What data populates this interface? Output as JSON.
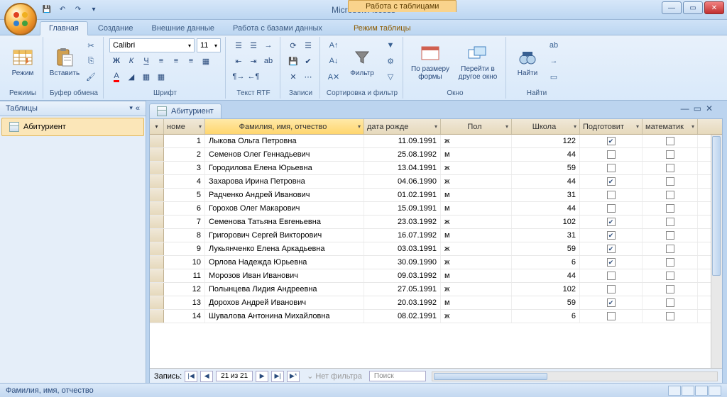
{
  "app": {
    "title": "Microsoft Access",
    "context_title": "Работа с таблицами"
  },
  "window_controls": {
    "min": "—",
    "max": "▭",
    "close": "✕"
  },
  "ribbon_tabs": {
    "items": [
      "Главная",
      "Создание",
      "Внешние данные",
      "Работа с базами данных",
      "Режим таблицы"
    ],
    "active_index": 0
  },
  "ribbon": {
    "views": {
      "label": "Режимы",
      "btn": "Режим"
    },
    "clipboard": {
      "label": "Буфер обмена",
      "paste": "Вставить"
    },
    "font": {
      "label": "Шрифт",
      "family": "Calibri",
      "size": "11"
    },
    "richtext": {
      "label": "Текст RTF"
    },
    "records": {
      "label": "Записи"
    },
    "sort_filter": {
      "label": "Сортировка и фильтр",
      "filter": "Фильтр"
    },
    "window": {
      "label": "Окно",
      "fit": "По размеру формы",
      "switch": "Перейти в другое окно"
    },
    "find": {
      "label": "Найти",
      "btn": "Найти"
    }
  },
  "navpane": {
    "header": "Таблицы",
    "item": "Абитуриент"
  },
  "document": {
    "tab_title": "Абитуриент",
    "columns": [
      "номе",
      "Фамилия, имя, отчество",
      "дата рожде",
      "Пол",
      "Школа",
      "Подготовит",
      "математик"
    ],
    "rows": [
      {
        "id": "1",
        "name": "Лыкова Ольга Петровна",
        "date": "11.09.1991",
        "sex": "ж",
        "school": "122",
        "prep": true
      },
      {
        "id": "2",
        "name": "Семенов Олег Геннадьевич",
        "date": "25.08.1992",
        "sex": "м",
        "school": "44",
        "prep": false
      },
      {
        "id": "3",
        "name": "Городилова Елена Юрьевна",
        "date": "13.04.1991",
        "sex": "ж",
        "school": "59",
        "prep": false
      },
      {
        "id": "4",
        "name": "Захарова Ирина Петровна",
        "date": "04.06.1990",
        "sex": "ж",
        "school": "44",
        "prep": true
      },
      {
        "id": "5",
        "name": "Радченко Андрей Иванович",
        "date": "01.02.1991",
        "sex": "м",
        "school": "31",
        "prep": false
      },
      {
        "id": "6",
        "name": "Горохов Олег Макарович",
        "date": "15.09.1991",
        "sex": "м",
        "school": "44",
        "prep": false
      },
      {
        "id": "7",
        "name": "Семенова Татьяна Евгеньевна",
        "date": "23.03.1992",
        "sex": "ж",
        "school": "102",
        "prep": true
      },
      {
        "id": "8",
        "name": "Григорович Сергей Викторович",
        "date": "16.07.1992",
        "sex": "м",
        "school": "31",
        "prep": true
      },
      {
        "id": "9",
        "name": "Лукьянченко Елена Аркадьевна",
        "date": "03.03.1991",
        "sex": "ж",
        "school": "59",
        "prep": true
      },
      {
        "id": "10",
        "name": "Орлова Надежда Юрьевна",
        "date": "30.09.1990",
        "sex": "ж",
        "school": "6",
        "prep": true
      },
      {
        "id": "11",
        "name": "Морозов Иван Иванович",
        "date": "09.03.1992",
        "sex": "м",
        "school": "44",
        "prep": false
      },
      {
        "id": "12",
        "name": "Полынцева Лидия Андреевна",
        "date": "27.05.1991",
        "sex": "ж",
        "school": "102",
        "prep": false
      },
      {
        "id": "13",
        "name": "Дорохов Андрей Иванович",
        "date": "20.03.1992",
        "sex": "м",
        "school": "59",
        "prep": true
      },
      {
        "id": "14",
        "name": "Шувалова Антонина Михайловна",
        "date": "08.02.1991",
        "sex": "ж",
        "school": "6",
        "prep": false
      }
    ],
    "record_nav": {
      "label": "Запись:",
      "position": "21 из 21",
      "no_filter": "Нет фильтра",
      "search": "Поиск"
    }
  },
  "statusbar": {
    "text": "Фамилия, имя, отчество"
  }
}
